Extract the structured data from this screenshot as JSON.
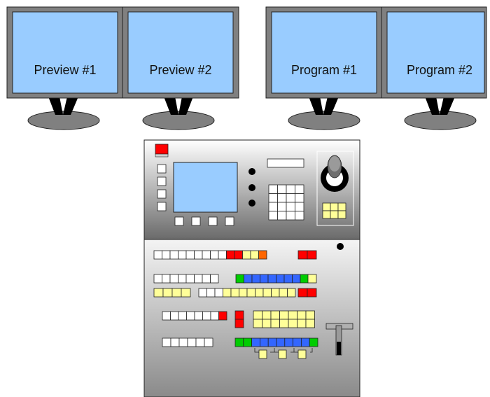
{
  "monitors": [
    {
      "label": "Preview #1"
    },
    {
      "label": "Preview #2"
    },
    {
      "label": "Program #1"
    },
    {
      "label": "Program #2"
    }
  ],
  "colors": {
    "screen": "#99ccff",
    "bezel": "#808080",
    "console_top": "#707070",
    "console_bottom": "#848484",
    "lcd": "#99ccff",
    "key_white": "#ffffff",
    "key_red": "#ff0000",
    "key_yellow": "#ffff99",
    "key_orange": "#ff6600",
    "key_green": "#00cc00",
    "key_blue": "#3366ff"
  },
  "icons": [
    "monitor-icon",
    "joystick-icon",
    "t-bar-fader-icon"
  ]
}
